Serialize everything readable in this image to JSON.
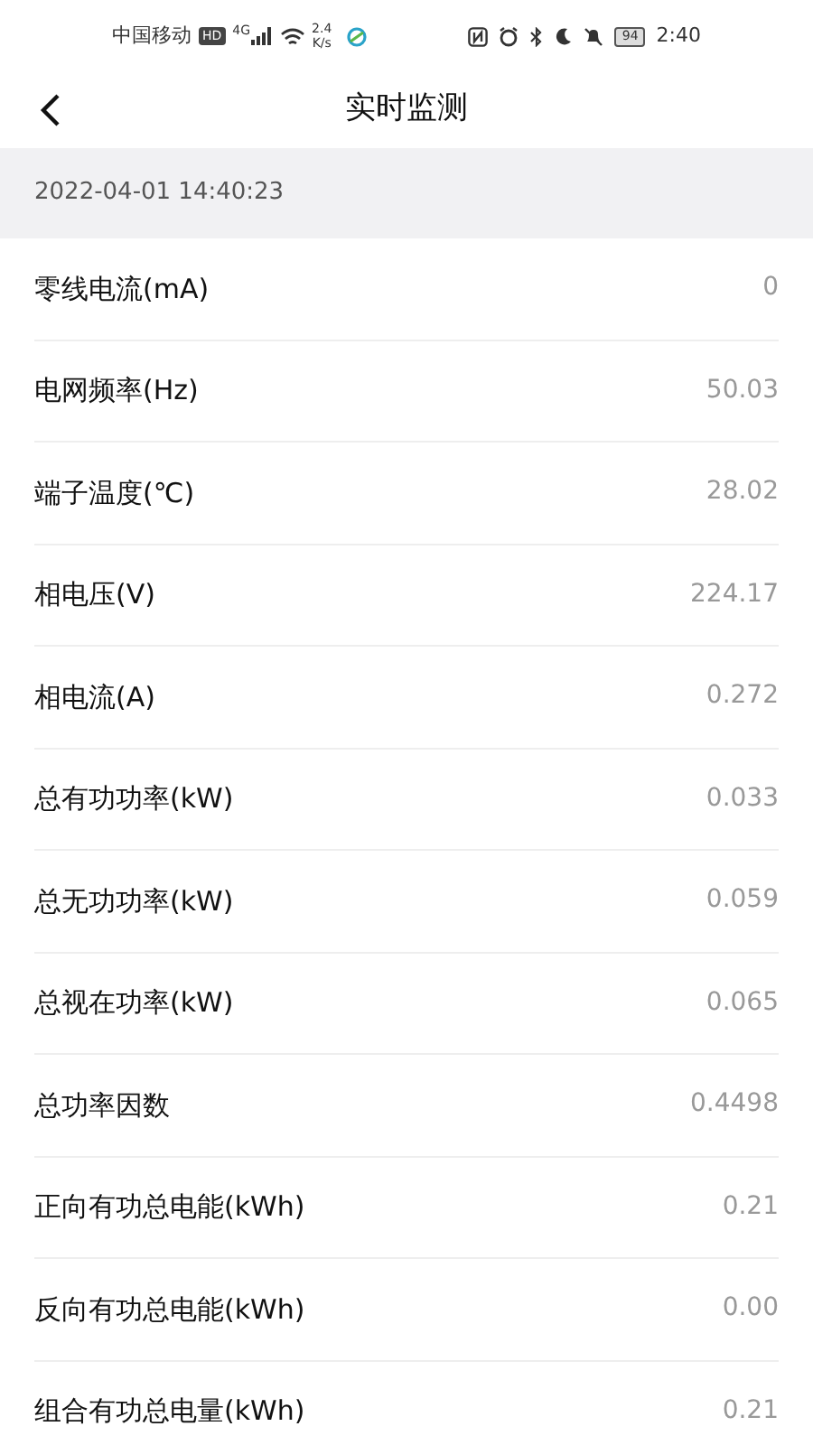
{
  "status_bar": {
    "carrier": "中国移动",
    "hd": "HD",
    "network": "4G",
    "speed": "2.4",
    "speed_unit": "K/s",
    "battery": "94",
    "time": "2:40"
  },
  "header": {
    "title": "实时监测"
  },
  "timestamp": "2022-04-01 14:40:23",
  "readings": [
    {
      "label": "零线电流(mA)",
      "value": "0"
    },
    {
      "label": "电网频率(Hz)",
      "value": "50.03"
    },
    {
      "label": "端子温度(℃)",
      "value": "28.02"
    },
    {
      "label": "相电压(V)",
      "value": "224.17"
    },
    {
      "label": "相电流(A)",
      "value": "0.272"
    },
    {
      "label": "总有功功率(kW)",
      "value": "0.033"
    },
    {
      "label": "总无功功率(kW)",
      "value": "0.059"
    },
    {
      "label": "总视在功率(kW)",
      "value": "0.065"
    },
    {
      "label": "总功率因数",
      "value": "0.4498"
    },
    {
      "label": "正向有功总电能(kWh)",
      "value": "0.21"
    },
    {
      "label": "反向有功总电能(kWh)",
      "value": "0.00"
    },
    {
      "label": "组合有功总电量(kWh)",
      "value": "0.21"
    }
  ]
}
